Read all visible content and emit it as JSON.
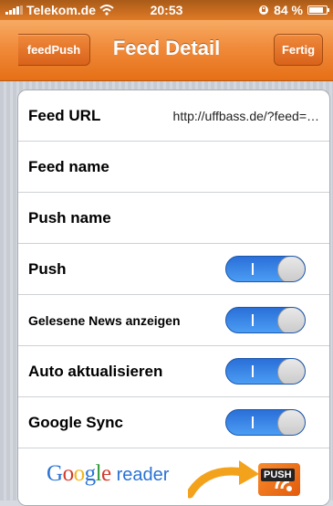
{
  "status_bar": {
    "carrier": "Telekom.de",
    "time": "20:53",
    "battery": "84 %",
    "battery_level": 0.84
  },
  "nav": {
    "back_label": "feedPush",
    "title": "Feed Detail",
    "done_label": "Fertig"
  },
  "rows": {
    "feed_url_label": "Feed URL",
    "feed_url_value": "http://uffbass.de/?feed=…",
    "feed_name_label": "Feed name",
    "push_name_label": "Push name",
    "push_label": "Push",
    "read_news_label": "Gelesene News anzeigen",
    "auto_refresh_label": "Auto aktualisieren",
    "google_sync_label": "Google Sync"
  },
  "toggles": {
    "push": true,
    "read_news": true,
    "auto_refresh": true,
    "google_sync": true
  },
  "banner": {
    "google_G": "G",
    "google_o1": "o",
    "google_o2": "o",
    "google_g": "g",
    "google_l": "l",
    "google_e": "e",
    "reader": "reader",
    "push_badge": "PUSH"
  },
  "colors": {
    "nav_orange": "#f08b3b",
    "toggle_blue": "#2f7fe6",
    "google_blue": "#2a73d5",
    "google_red": "#d33b2c",
    "google_yellow": "#f3b51b",
    "google_green": "#2f9a3a"
  },
  "icons": [
    "signal-icon",
    "wifi-icon",
    "battery-icon",
    "orientation-lock-icon",
    "rss-icon",
    "arrow-icon"
  ]
}
